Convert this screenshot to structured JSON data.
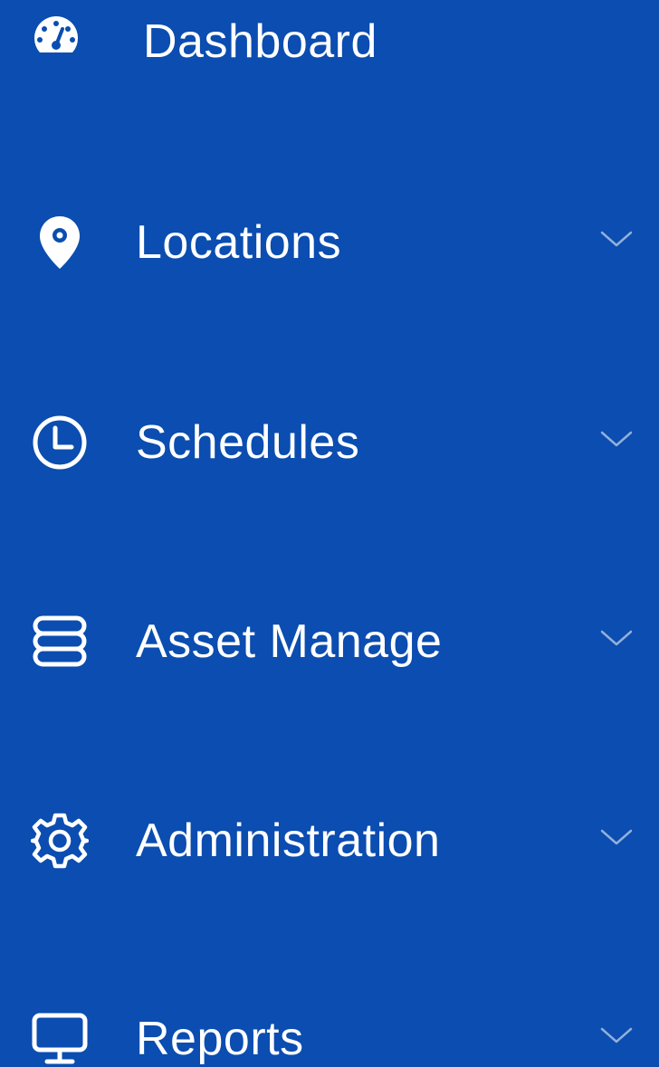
{
  "theme": {
    "background": "#0B4DB0",
    "text": "#FFFFFF"
  },
  "sidebar": {
    "items": [
      {
        "label": "Dashboard",
        "icon": "dashboard-gauge-icon",
        "has_submenu": false
      },
      {
        "label": "Locations",
        "icon": "location-pin-icon",
        "has_submenu": true
      },
      {
        "label": "Schedules",
        "icon": "clock-icon",
        "has_submenu": true
      },
      {
        "label": "Asset Manage",
        "icon": "database-icon",
        "has_submenu": true
      },
      {
        "label": "Administration",
        "icon": "gear-icon",
        "has_submenu": true
      },
      {
        "label": "Reports",
        "icon": "monitor-icon",
        "has_submenu": true
      }
    ]
  }
}
